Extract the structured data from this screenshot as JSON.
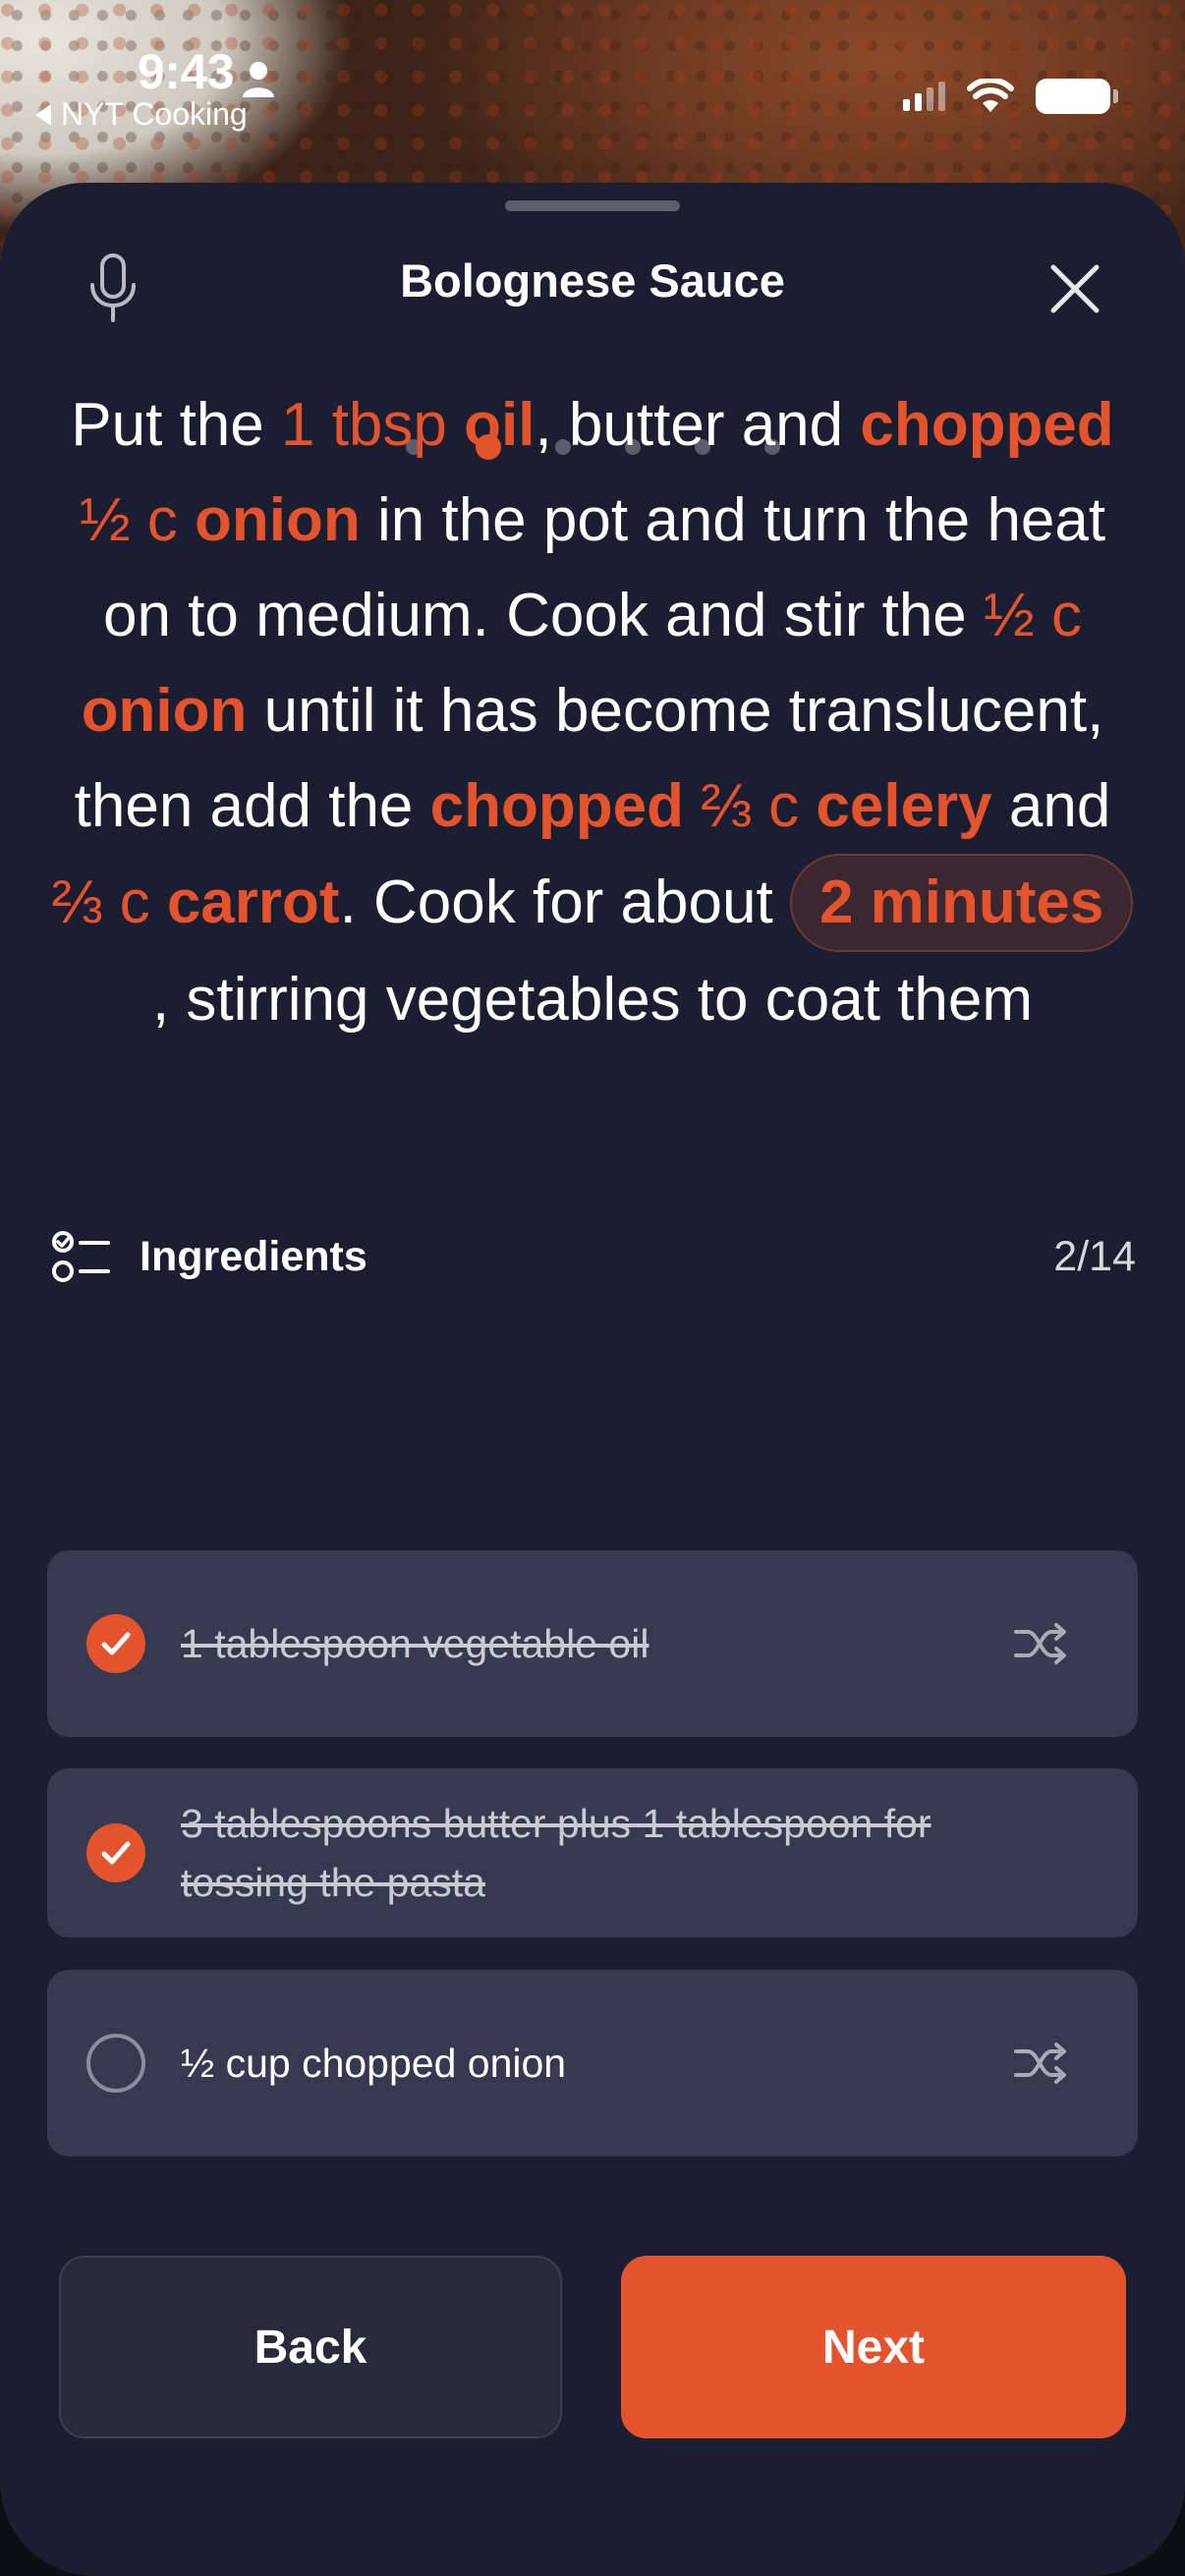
{
  "status_bar": {
    "time": "9:43",
    "back_app": "NYT Cooking"
  },
  "header": {
    "title": "Bolognese Sauce"
  },
  "steps": {
    "count": 6,
    "active_index": 1
  },
  "step_text": [
    {
      "t": "Put the "
    },
    {
      "t": "1 tbsp",
      "s": "qty"
    },
    {
      "t": " "
    },
    {
      "t": "oil",
      "s": "ing"
    },
    {
      "t": ", butter and "
    },
    {
      "t": "chopped",
      "s": "ing"
    },
    {
      "t": " "
    },
    {
      "t": "½ c",
      "s": "qty"
    },
    {
      "t": " "
    },
    {
      "t": "onion",
      "s": "ing"
    },
    {
      "t": " in the pot and turn the heat on to medium. Cook and stir the "
    },
    {
      "t": "½ c",
      "s": "qty"
    },
    {
      "t": " "
    },
    {
      "t": "onion",
      "s": "ing"
    },
    {
      "t": " until it has become translucent, then add the "
    },
    {
      "t": "chopped",
      "s": "ing"
    },
    {
      "t": " "
    },
    {
      "t": "⅔ c",
      "s": "qty"
    },
    {
      "t": " "
    },
    {
      "t": "celery",
      "s": "ing"
    },
    {
      "t": " and "
    },
    {
      "t": "⅔ c",
      "s": "qty"
    },
    {
      "t": " "
    },
    {
      "t": "carrot",
      "s": "ing"
    },
    {
      "t": ". Cook for about "
    },
    {
      "t": "2 minutes",
      "s": "timer"
    },
    {
      "t": ", stirring vegetables to coat them"
    }
  ],
  "ingredients": {
    "label": "Ingredients",
    "count": "2/14",
    "items": [
      {
        "text": "1 tablespoon vegetable oil",
        "checked": true,
        "swap": true
      },
      {
        "text": "3 tablespoons butter plus 1 tablespoon for tossing the pasta",
        "checked": true,
        "swap": false
      },
      {
        "text": "½ cup chopped onion",
        "checked": false,
        "swap": true
      }
    ]
  },
  "buttons": {
    "back": "Back",
    "next": "Next"
  },
  "colors": {
    "accent": "#e3532e",
    "sheet": "#1b1e30",
    "card": "#363a50"
  },
  "icons": [
    "person-icon",
    "back-triangle-icon",
    "signal-icon",
    "wifi-icon",
    "battery-icon",
    "microphone-icon",
    "close-icon",
    "checklist-icon",
    "checkmark-icon",
    "shuffle-icon"
  ]
}
